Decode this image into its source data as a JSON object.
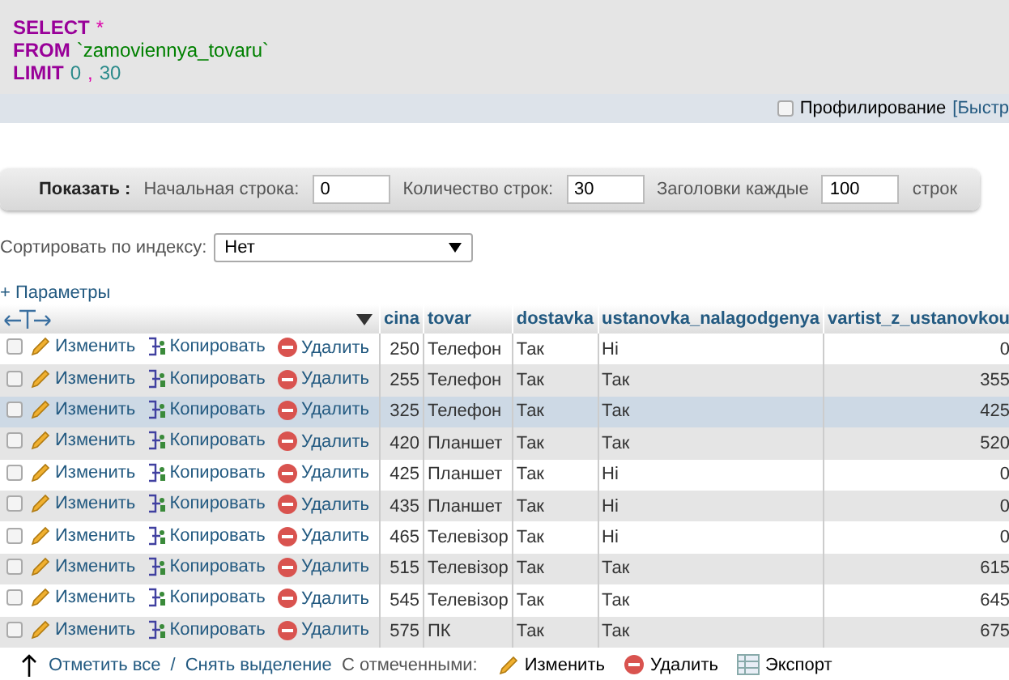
{
  "query": {
    "lines": [
      [
        {
          "kind": "keyword",
          "text": "SELECT"
        },
        {
          "kind": "operator",
          "text": "*"
        }
      ],
      [
        {
          "kind": "keyword",
          "text": "FROM"
        },
        {
          "kind": "name",
          "text": "`zamoviennya_tovaru`"
        }
      ],
      [
        {
          "kind": "keyword",
          "text": "LIMIT"
        },
        {
          "kind": "number",
          "text": "0"
        },
        {
          "kind": "operator",
          "text": ","
        },
        {
          "kind": "number",
          "text": "30"
        }
      ]
    ]
  },
  "profiling": {
    "label": "Профилирование",
    "checked": false,
    "link": "[Быстр"
  },
  "display": {
    "label": "Показать :",
    "fields": [
      {
        "label": "Начальная строка:",
        "value": "0"
      },
      {
        "label": "Количество строк:",
        "value": "30"
      },
      {
        "label": "Заголовки каждые",
        "value": "100"
      }
    ],
    "suffix": "строк"
  },
  "sort": {
    "label": "Сортировать по индексу:",
    "value": "Нет"
  },
  "options_link": "+ Параметры",
  "table": {
    "columns": [
      "cina",
      "tovar",
      "dostavka",
      "ustanovka_nalagodgenya",
      "vartist_z_ustanovkou"
    ],
    "rows": [
      {
        "checked": false,
        "highlighted": false,
        "actions": [
          "Изменить",
          "Копировать",
          "Удалить"
        ],
        "cells": [
          "250",
          "Телефон",
          "Так",
          "Ні",
          "0"
        ]
      },
      {
        "checked": false,
        "highlighted": false,
        "actions": [
          "Изменить",
          "Копировать",
          "Удалить"
        ],
        "cells": [
          "255",
          "Телефон",
          "Так",
          "Так",
          "355"
        ]
      },
      {
        "checked": false,
        "highlighted": true,
        "actions": [
          "Изменить",
          "Копировать",
          "Удалить"
        ],
        "cells": [
          "325",
          "Телефон",
          "Так",
          "Так",
          "425"
        ]
      },
      {
        "checked": false,
        "highlighted": false,
        "actions": [
          "Изменить",
          "Копировать",
          "Удалить"
        ],
        "cells": [
          "420",
          "Планшет",
          "Так",
          "Так",
          "520"
        ]
      },
      {
        "checked": false,
        "highlighted": false,
        "actions": [
          "Изменить",
          "Копировать",
          "Удалить"
        ],
        "cells": [
          "425",
          "Планшет",
          "Так",
          "Ні",
          "0"
        ]
      },
      {
        "checked": false,
        "highlighted": false,
        "actions": [
          "Изменить",
          "Копировать",
          "Удалить"
        ],
        "cells": [
          "435",
          "Планшет",
          "Так",
          "Ні",
          "0"
        ]
      },
      {
        "checked": false,
        "highlighted": false,
        "actions": [
          "Изменить",
          "Копировать",
          "Удалить"
        ],
        "cells": [
          "465",
          "Телевізор",
          "Так",
          "Ні",
          "0"
        ]
      },
      {
        "checked": false,
        "highlighted": false,
        "actions": [
          "Изменить",
          "Копировать",
          "Удалить"
        ],
        "cells": [
          "515",
          "Телевізор",
          "Так",
          "Так",
          "615"
        ]
      },
      {
        "checked": false,
        "highlighted": false,
        "actions": [
          "Изменить",
          "Копировать",
          "Удалить"
        ],
        "cells": [
          "545",
          "Телевізор",
          "Так",
          "Так",
          "645"
        ]
      },
      {
        "checked": false,
        "highlighted": false,
        "actions": [
          "Изменить",
          "Копировать",
          "Удалить"
        ],
        "cells": [
          "575",
          "ПК",
          "Так",
          "Так",
          "675"
        ]
      }
    ]
  },
  "footer": {
    "check_all": "Отметить все",
    "separator": "/",
    "uncheck": "Снять выделение",
    "with_selected": "С отмеченными:",
    "actions": [
      {
        "kind": "edit",
        "label": "Изменить"
      },
      {
        "kind": "delete",
        "label": "Удалить"
      },
      {
        "kind": "export",
        "label": "Экспорт"
      }
    ]
  }
}
